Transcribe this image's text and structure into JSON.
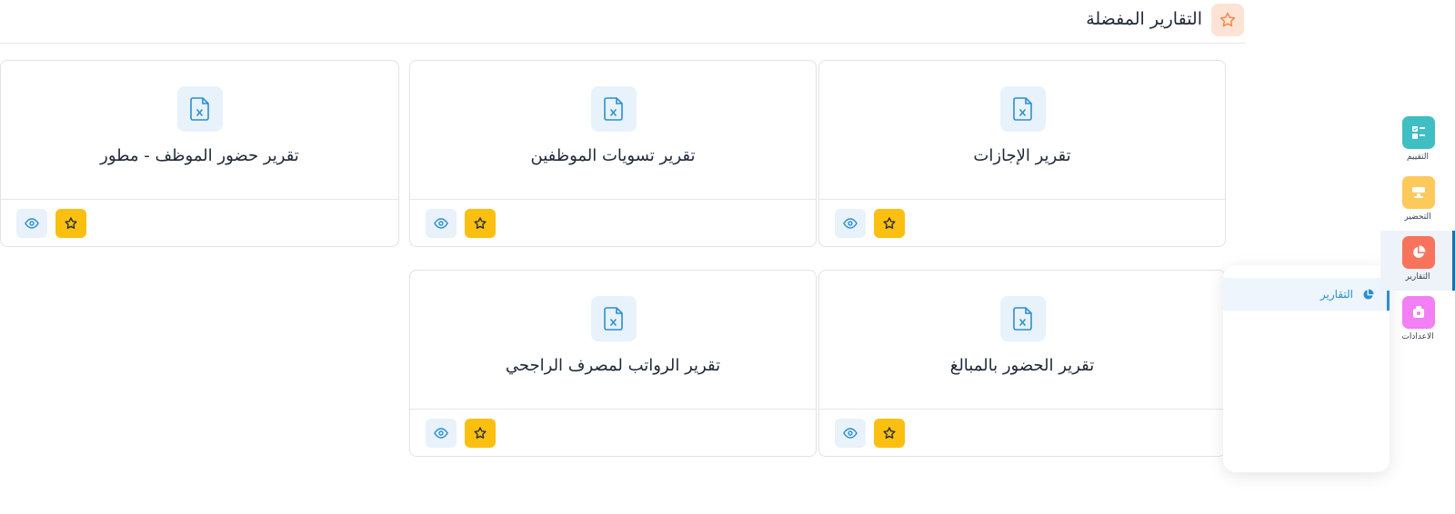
{
  "header": {
    "title": "التقارير المفضلة",
    "icon": "star-icon"
  },
  "reports": [
    {
      "title": "تقرير الإجازات"
    },
    {
      "title": "تقرير تسويات الموظفين"
    },
    {
      "title": "تقرير حضور الموظف - مطور"
    },
    {
      "title": "تقرير الحضور بالمبالغ"
    },
    {
      "title": "تقرير الرواتب لمصرف الراجحي"
    }
  ],
  "flyout": {
    "label": "التقارير",
    "icon": "pie-chart-icon"
  },
  "rail": [
    {
      "label": "التقييم",
      "icon": "evaluation-icon",
      "color": "#3fbfc3"
    },
    {
      "label": "التحضير",
      "icon": "attendance-icon",
      "color": "#fcc95a"
    },
    {
      "label": "التقارير",
      "icon": "pie-chart-icon",
      "color": "#f8735c"
    },
    {
      "label": "الاعدادات",
      "icon": "settings-icon",
      "color": "#f27ff3"
    }
  ],
  "colors": {
    "accent": "#2a8fd0",
    "favorite": "#fbbf0f",
    "view_bg": "#e9f2fa",
    "header_star_bg": "#fde3d6",
    "header_star": "#f08a4b"
  }
}
